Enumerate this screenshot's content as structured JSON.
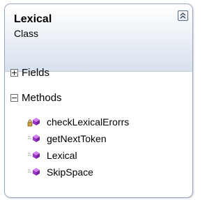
{
  "class": {
    "name": "Lexical",
    "kind": "Class"
  },
  "sections": {
    "fields": {
      "label": "Fields",
      "expanded": false
    },
    "methods": {
      "label": "Methods",
      "expanded": true
    }
  },
  "methods": [
    {
      "name": "checkLexicalErorrs",
      "icon": "private-method-icon"
    },
    {
      "name": "getNextToken",
      "icon": "public-method-icon"
    },
    {
      "name": "Lexical",
      "icon": "public-method-icon"
    },
    {
      "name": "SkipSpace",
      "icon": "public-method-icon"
    }
  ],
  "colors": {
    "method_icon": "#b04fd8",
    "header_gradient_end": "#d7e0ee",
    "border": "#9aa8bd"
  }
}
